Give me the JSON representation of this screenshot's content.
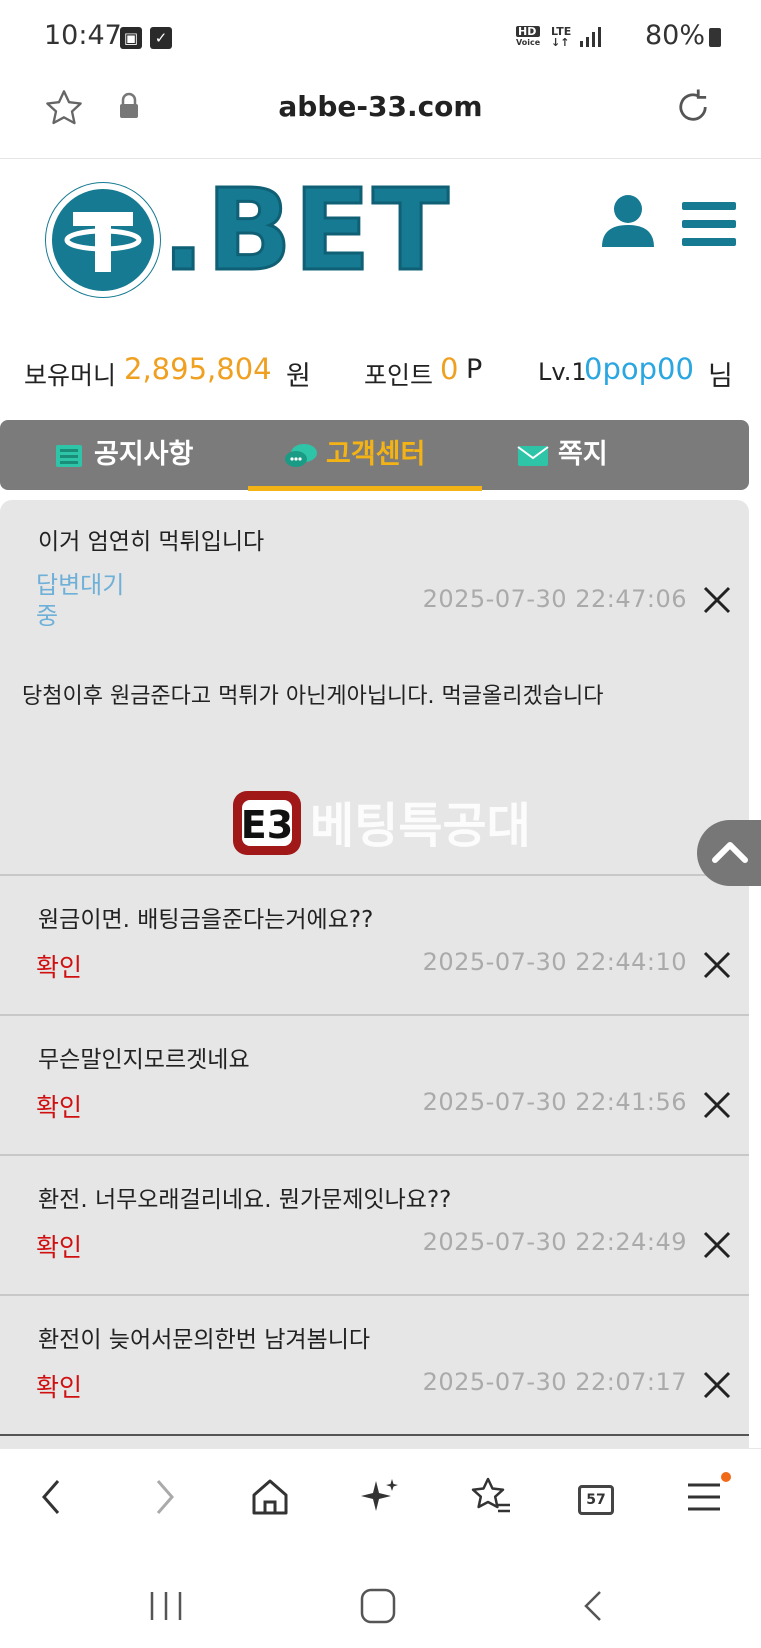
{
  "status_bar": {
    "time": "10:47",
    "right_text": "80%",
    "hd_label": "HD",
    "voice_label": "Voice",
    "lte_label": "LTE",
    "battery_percent": 80
  },
  "browser": {
    "url": "abbe-33.com",
    "tabs_count": "57"
  },
  "site": {
    "logo_text": ".BET",
    "brand_color": "#157a92"
  },
  "balance": {
    "money_label": "보유머니",
    "money_value": "2,895,804",
    "money_unit": "원",
    "point_label": "포인트",
    "point_value": "0",
    "point_unit": "P",
    "level_prefix": "Lv.1",
    "username": "0pop00",
    "suffix": "님"
  },
  "tabs": [
    {
      "label": "공지사항",
      "icon": "notebook-icon"
    },
    {
      "label": "고객센터",
      "icon": "chat-bubbles-icon",
      "active": true
    },
    {
      "label": "쪽지",
      "icon": "envelope-icon"
    }
  ],
  "messages": [
    {
      "title": "이거 엄연히 먹튀입니다",
      "status_line1": "답변대기",
      "status_line2": "중",
      "date": "2025-07-30 22:47:06",
      "body": "당첨이후 원금준다고 먹튀가 아닌게아닙니다. 먹글올리겠습니다"
    },
    {
      "title": "원금이면. 배팅금을준다는거에요??",
      "status": "확인",
      "date": "2025-07-30 22:44:10"
    },
    {
      "title": "무슨말인지모르겟네요",
      "status": "확인",
      "date": "2025-07-30 22:41:56"
    },
    {
      "title": "환전. 너무오래걸리네요. 뭔가문제잇나요??",
      "status": "확인",
      "date": "2025-07-30 22:24:49"
    },
    {
      "title": "환전이 늦어서문의한번 남겨봄니다",
      "status": "확인",
      "date": "2025-07-30 22:07:17"
    }
  ],
  "watermark": {
    "text": "베팅특공대"
  }
}
